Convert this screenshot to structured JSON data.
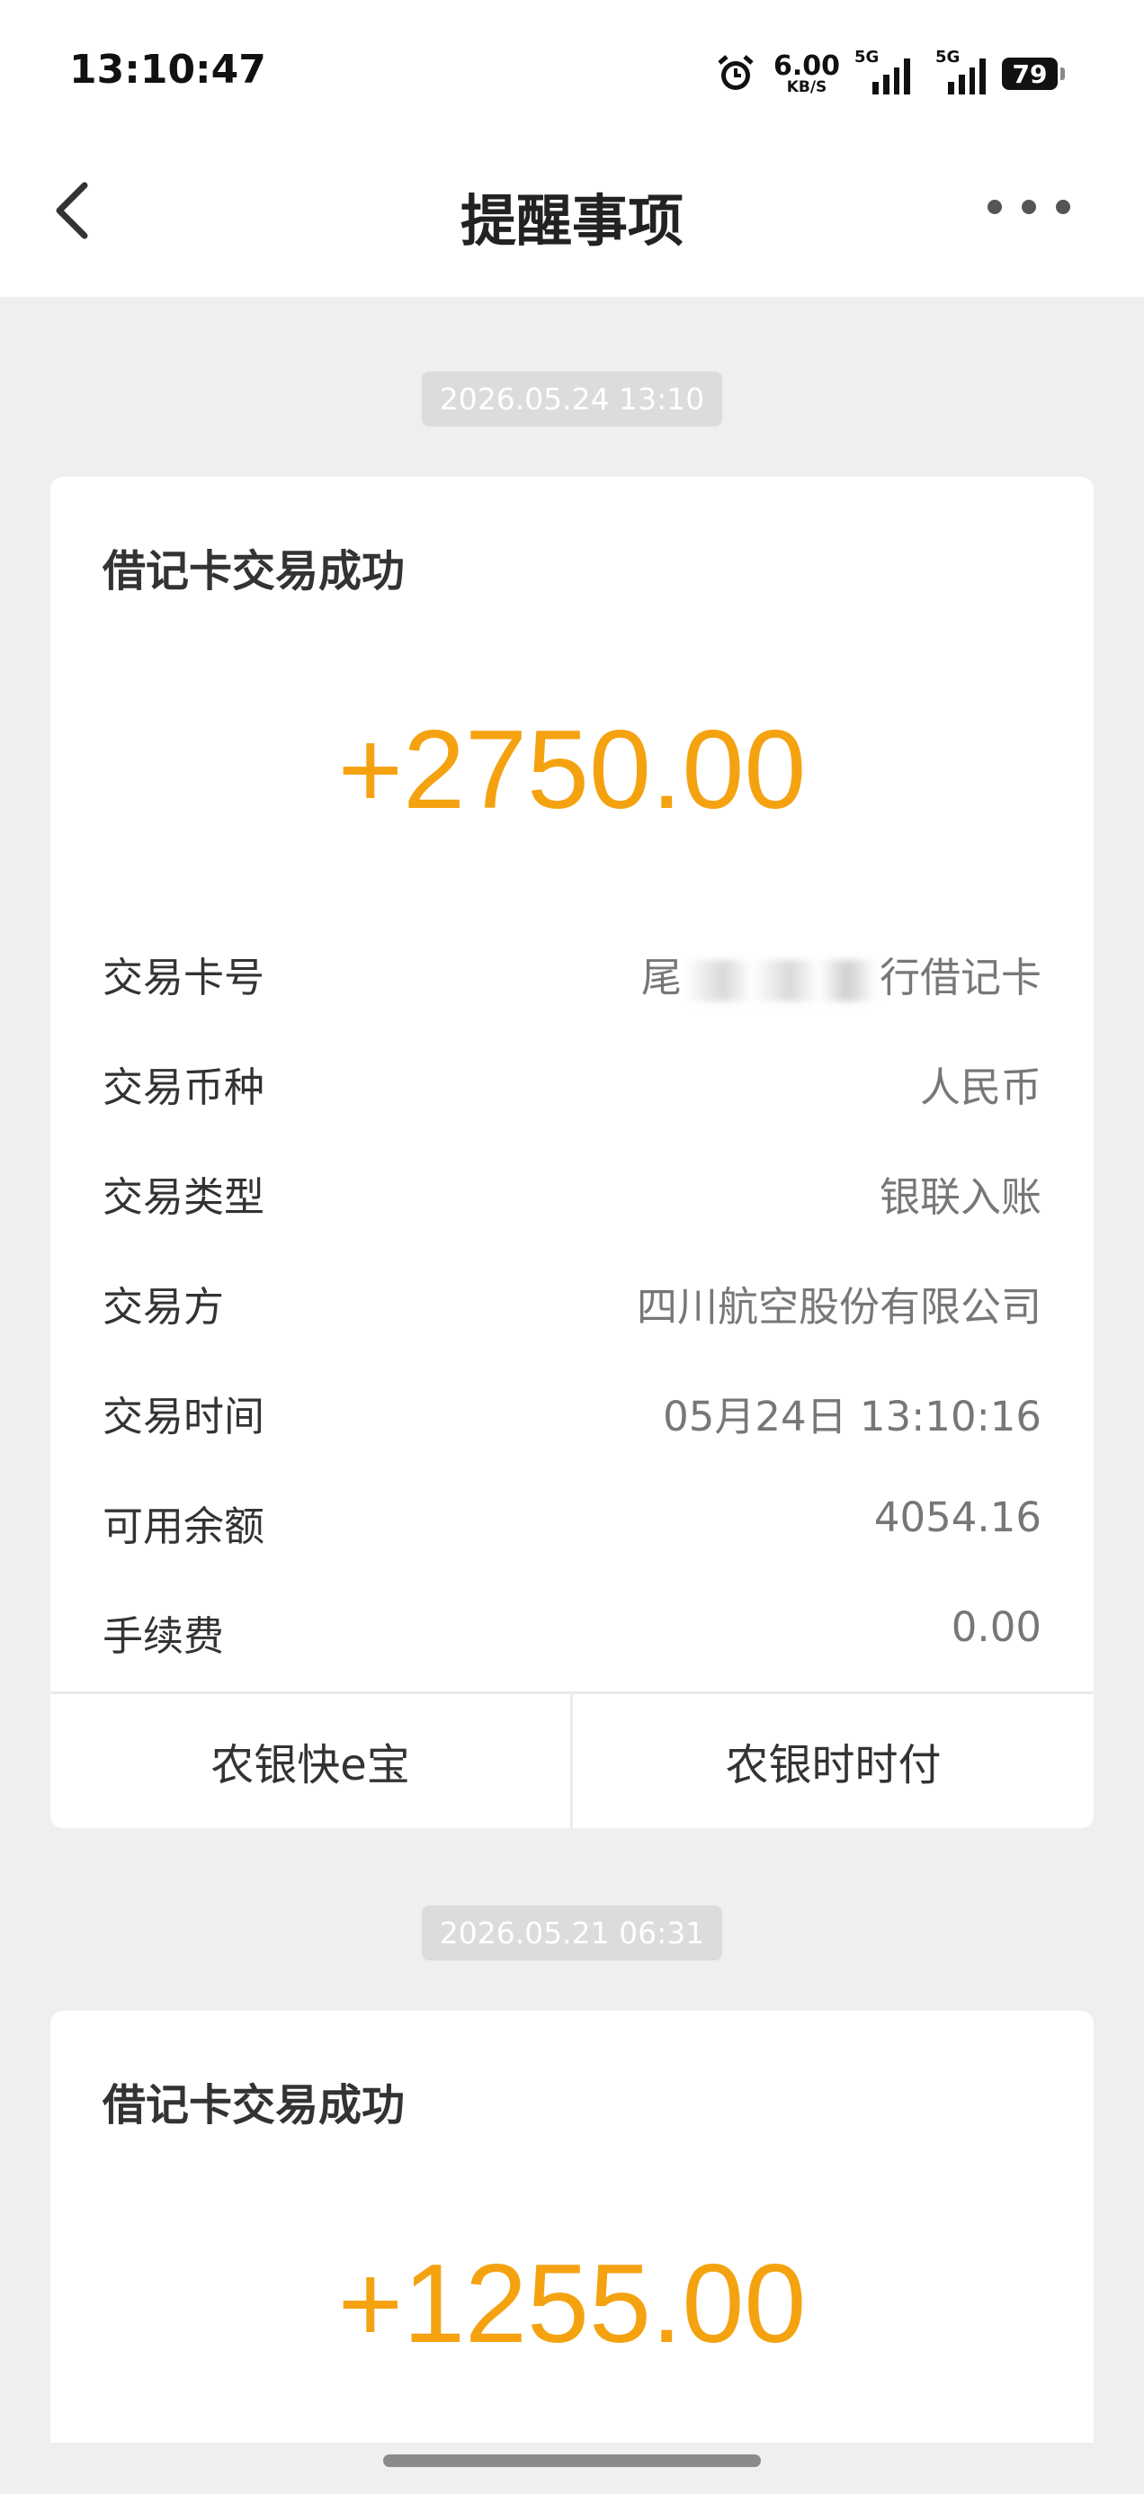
{
  "status_bar": {
    "time": "13:10:47",
    "net_speed": "6.00",
    "net_unit": "KB/S",
    "signal1_label": "5G",
    "signal2_label": "5G",
    "battery": "79"
  },
  "navbar": {
    "title": "提醒事项"
  },
  "messages": [
    {
      "timestamp": "2026.05.24 13:10",
      "title": "借记卡交易成功",
      "amount": "+2750.00",
      "rows": [
        {
          "label": "交易卡号",
          "value_prefix": "尾",
          "value_suffix": "行借记卡"
        },
        {
          "label": "交易币种",
          "value": "人民币"
        },
        {
          "label": "交易类型",
          "value": "银联入账"
        },
        {
          "label": "交易方",
          "value": "四川航空股份有限公司"
        },
        {
          "label": "交易时间",
          "value": "05月24日 13:10:16"
        },
        {
          "label": "可用余额",
          "value": "4054.16"
        },
        {
          "label": "手续费",
          "value": "0.00"
        }
      ],
      "actions": [
        "农银快e宝",
        "农银时时付"
      ]
    },
    {
      "timestamp": "2026.05.21 06:31",
      "title": "借记卡交易成功",
      "amount": "+1255.00"
    }
  ],
  "colors": {
    "amount": "#f5a211",
    "background": "#efefef"
  }
}
